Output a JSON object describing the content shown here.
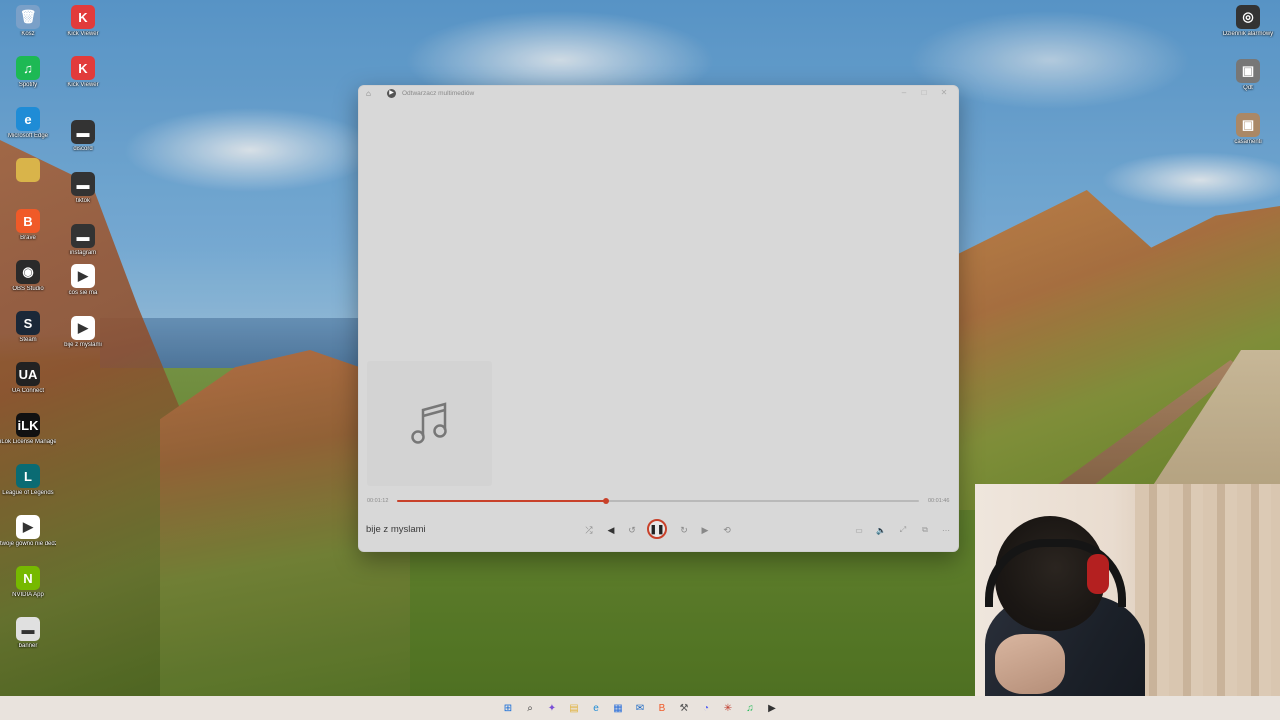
{
  "desktop": {
    "icons_left": [
      {
        "label": "Kosz",
        "glyph": "🗑",
        "color": "#7aa0c8"
      },
      {
        "label": "Spotify",
        "glyph": "♫",
        "color": "#1db954"
      },
      {
        "label": "Microsoft Edge",
        "glyph": "e",
        "color": "#1f8cd6"
      },
      {
        "label": "",
        "glyph": "",
        "color": "#d9b44a"
      },
      {
        "label": "Brave",
        "glyph": "B",
        "color": "#f05a28"
      },
      {
        "label": "OBS Studio",
        "glyph": "◉",
        "color": "#2a2a2a"
      },
      {
        "label": "Steam",
        "glyph": "S",
        "color": "#1b2838"
      },
      {
        "label": "UA Connect",
        "glyph": "UA",
        "color": "#222222"
      },
      {
        "label": "iLok License Manager",
        "glyph": "iLK",
        "color": "#111111"
      },
      {
        "label": "League of Legends",
        "glyph": "L",
        "color": "#0a6b73"
      },
      {
        "label": "twoje gówno nie dedza",
        "glyph": "▶",
        "color": "#ffffff"
      },
      {
        "label": "NVIDIA App",
        "glyph": "N",
        "color": "#76b900"
      },
      {
        "label": "banner",
        "glyph": "▬",
        "color": "#e0e0e0"
      }
    ],
    "icons_col2": [
      {
        "label": "Kick Viewer",
        "glyph": "K",
        "color": "#e23b3b"
      },
      {
        "label": "Kick Viewer",
        "glyph": "K",
        "color": "#e23b3b"
      },
      {
        "label": "discord",
        "glyph": "▬",
        "color": "#333333"
      },
      {
        "label": "tiktok",
        "glyph": "▬",
        "color": "#333333"
      },
      {
        "label": "instagram",
        "glyph": "▬",
        "color": "#333333"
      },
      {
        "label": "cos sie ma",
        "glyph": "▶",
        "color": "#ffffff"
      },
      {
        "label": "bije z myslami",
        "glyph": "▶",
        "color": "#ffffff"
      }
    ],
    "icons_right": [
      {
        "label": "Dziennik alarmowy",
        "glyph": "◎",
        "color": "#333333"
      },
      {
        "label": "Qdt",
        "glyph": "▣",
        "color": "#777777"
      },
      {
        "label": "casamenti",
        "glyph": "▣",
        "color": "#aa8866"
      }
    ]
  },
  "player": {
    "window_title": "Odtwarzacz multimediów",
    "track_title": "bije z myslami",
    "time_elapsed": "00:01:12",
    "time_total": "00:01:46",
    "progress": 0.4,
    "controls": {
      "shuffle": "⤮",
      "previous": "◀",
      "rewind": "↺",
      "pause": "❚❚",
      "forward": "↻",
      "next": "▶",
      "repeat": "⟲"
    },
    "right_controls": [
      "▭",
      "🔈",
      "⤢",
      "⧉",
      "⋯"
    ],
    "accent_color": "#c8412a"
  },
  "taskbar": {
    "icons": [
      {
        "name": "start",
        "glyph": "⊞",
        "color": "#0a66d8"
      },
      {
        "name": "search",
        "glyph": "⌕",
        "color": "#333333"
      },
      {
        "name": "copilot",
        "glyph": "✦",
        "color": "#7a4fd6"
      },
      {
        "name": "file-explorer",
        "glyph": "▤",
        "color": "#e0b23c"
      },
      {
        "name": "edge",
        "glyph": "e",
        "color": "#1f8cd6"
      },
      {
        "name": "store",
        "glyph": "▦",
        "color": "#2a6fdb"
      },
      {
        "name": "mail",
        "glyph": "✉",
        "color": "#1766c4"
      },
      {
        "name": "brave",
        "glyph": "B",
        "color": "#f05a28"
      },
      {
        "name": "tools",
        "glyph": "⚒",
        "color": "#555555"
      },
      {
        "name": "discord",
        "glyph": "◔",
        "color": "#5865f2"
      },
      {
        "name": "app",
        "glyph": "✳",
        "color": "#c0392b"
      },
      {
        "name": "spotify",
        "glyph": "♫",
        "color": "#1db954"
      },
      {
        "name": "media-player",
        "glyph": "▶",
        "color": "#333333"
      }
    ]
  }
}
